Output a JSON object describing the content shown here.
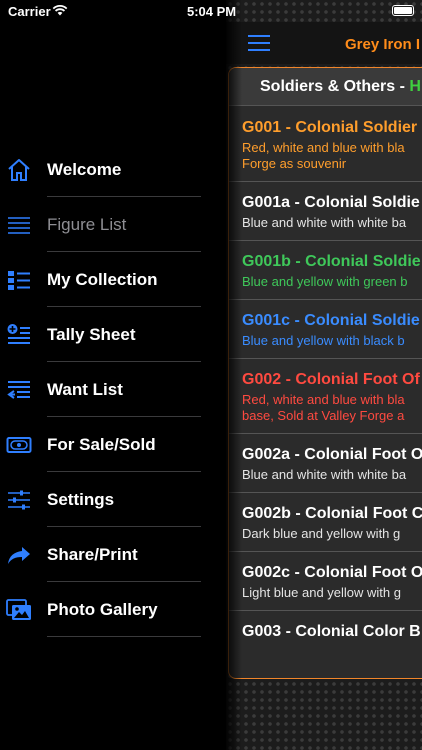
{
  "status_bar": {
    "carrier": "Carrier",
    "time": "5:04 PM"
  },
  "menu": {
    "items": [
      {
        "label": "Welcome",
        "icon": "home-icon",
        "dim": false
      },
      {
        "label": "Figure List",
        "icon": "list-lines-icon",
        "dim": true
      },
      {
        "label": "My Collection",
        "icon": "collection-list-icon",
        "dim": false
      },
      {
        "label": "Tally Sheet",
        "icon": "tally-add-icon",
        "dim": false
      },
      {
        "label": "Want List",
        "icon": "want-list-icon",
        "dim": false
      },
      {
        "label": "For Sale/Sold",
        "icon": "money-icon",
        "dim": false
      },
      {
        "label": "Settings",
        "icon": "sliders-icon",
        "dim": false
      },
      {
        "label": "Share/Print",
        "icon": "share-arrow-icon",
        "dim": false
      },
      {
        "label": "Photo Gallery",
        "icon": "photo-gallery-icon",
        "dim": false
      }
    ]
  },
  "nav": {
    "title": "Grey Iron I"
  },
  "list": {
    "header_prefix": "Soldiers & Others - ",
    "header_accent": "H",
    "rows": [
      {
        "title": "G001 - Colonial Soldier",
        "desc1": "Red, white and blue with bla",
        "desc2": "Forge as souvenir",
        "color": "orange"
      },
      {
        "title": "G001a - Colonial Soldie",
        "desc1": "Blue and white with white ba",
        "desc2": "",
        "color": "white"
      },
      {
        "title": "G001b - Colonial Soldie",
        "desc1": "Blue and yellow with green b",
        "desc2": "",
        "color": "green"
      },
      {
        "title": "G001c - Colonial Soldie",
        "desc1": "Blue and yellow with black b",
        "desc2": "",
        "color": "blue"
      },
      {
        "title": "G002 - Colonial Foot Of",
        "desc1": "Red, white and blue with bla",
        "desc2": "base, Sold at Valley Forge a",
        "color": "red"
      },
      {
        "title": "G002a - Colonial Foot O",
        "desc1": "Blue and white with white ba",
        "desc2": "",
        "color": "white"
      },
      {
        "title": "G002b - Colonial Foot C",
        "desc1": "Dark blue and yellow with g",
        "desc2": "",
        "color": "white"
      },
      {
        "title": "G002c - Colonial Foot O",
        "desc1": "Light blue and yellow with g",
        "desc2": "",
        "color": "white"
      },
      {
        "title": "G003 - Colonial Color B",
        "desc1": "",
        "desc2": "",
        "color": "white"
      }
    ]
  },
  "colors": {
    "accent_orange": "#f0852a",
    "icon_blue": "#2f7fff",
    "header_accent_green": "#3fd03f"
  }
}
